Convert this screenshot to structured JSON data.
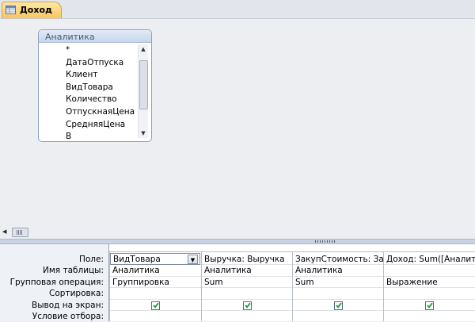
{
  "tab": {
    "title": "Доход",
    "icon": "query-icon"
  },
  "field_list": {
    "title": "Аналитика",
    "fields": [
      "*",
      "ДатаОтпуска",
      "Клиент",
      "ВидТовара",
      "Количество",
      "ОтпускнаяЦена",
      "СредняяЦена",
      "В"
    ]
  },
  "grid": {
    "row_labels": [
      "Поле:",
      "Имя таблицы:",
      "Групповая операция:",
      "Сортировка:",
      "Вывод на экран:",
      "Условие отбора:"
    ],
    "columns": [
      {
        "field": "ВидТовара",
        "table": "Аналитика",
        "group_op": "Группировка",
        "sort": "",
        "show": true
      },
      {
        "field": "Выручка: Выручка",
        "table": "Аналитика",
        "group_op": "Sum",
        "sort": "",
        "show": true
      },
      {
        "field": "ЗакупСтоимость: Зак",
        "table": "Аналитика",
        "group_op": "Sum",
        "sort": "",
        "show": true
      },
      {
        "field": "Доход: Sum([Аналити",
        "table": "",
        "group_op": "Выражение",
        "sort": "",
        "show": true
      }
    ]
  }
}
